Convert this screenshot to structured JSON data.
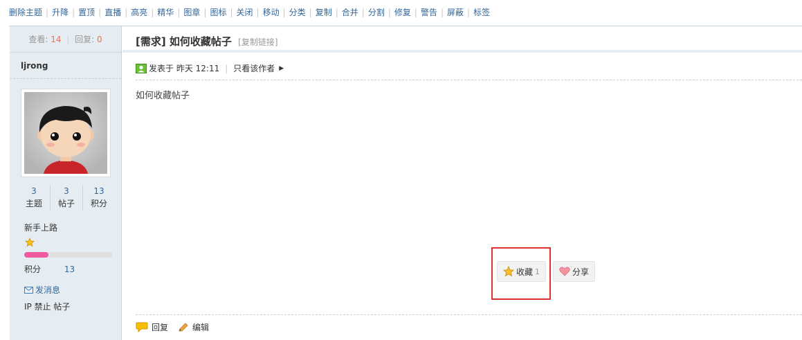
{
  "modbar": {
    "items": [
      "删除主题",
      "升降",
      "置顶",
      "直播",
      "高亮",
      "精华",
      "图章",
      "图标",
      "关闭",
      "移动",
      "分类",
      "复制",
      "合并",
      "分割",
      "修复",
      "警告",
      "屏蔽",
      "标签"
    ]
  },
  "author": {
    "views_label": "查看:",
    "views": "14",
    "replies_label": "回复:",
    "replies": "0",
    "name": "ljrong",
    "stats": [
      {
        "value": "3",
        "label": "主题"
      },
      {
        "value": "3",
        "label": "帖子"
      },
      {
        "value": "13",
        "label": "积分"
      }
    ],
    "level": "新手上路",
    "level_progress": 0.27,
    "jifen_label": "积分",
    "jifen_value": "13",
    "send_message": "发消息",
    "ip_ban": "IP 禁止 帖子"
  },
  "post": {
    "title": "[需求] 如何收藏帖子",
    "copy_link": "[复制链接]",
    "posted_label": "发表于 昨天 12:11",
    "only_author": "只看该作者",
    "content": "如何收藏帖子",
    "favorite_label": "收藏",
    "favorite_count": "1",
    "share_label": "分享",
    "reply_label": "回复",
    "edit_label": "编辑"
  },
  "colors": {
    "accent_link": "#336699",
    "highlight": "#e03131",
    "progress": "#ed5aa0",
    "side_bg": "#e5edf2"
  }
}
